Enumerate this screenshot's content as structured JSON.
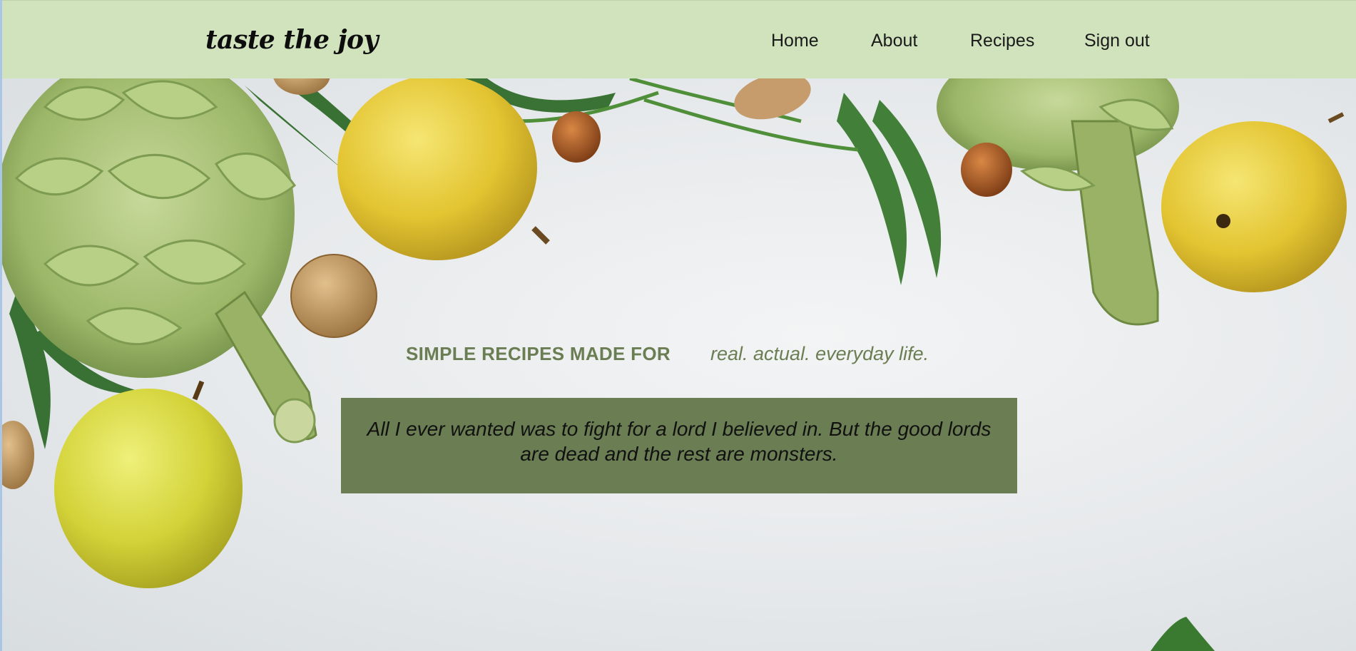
{
  "brand": {
    "name": "taste the joy"
  },
  "nav": {
    "items": [
      {
        "label": "Home"
      },
      {
        "label": "About"
      },
      {
        "label": "Recipes"
      },
      {
        "label": "Sign out"
      }
    ]
  },
  "hero": {
    "tagline_strong": "SIMPLE RECIPES MADE FOR",
    "tagline_em": "real. actual. everyday life.",
    "quote": "All I ever wanted was to fight for a lord I believed in. But the good lords are dead and the rest are monsters."
  },
  "colors": {
    "header_bg": "#d1e3bd",
    "accent_green": "#6b7d52",
    "hero_bg": "#e9ecee"
  }
}
